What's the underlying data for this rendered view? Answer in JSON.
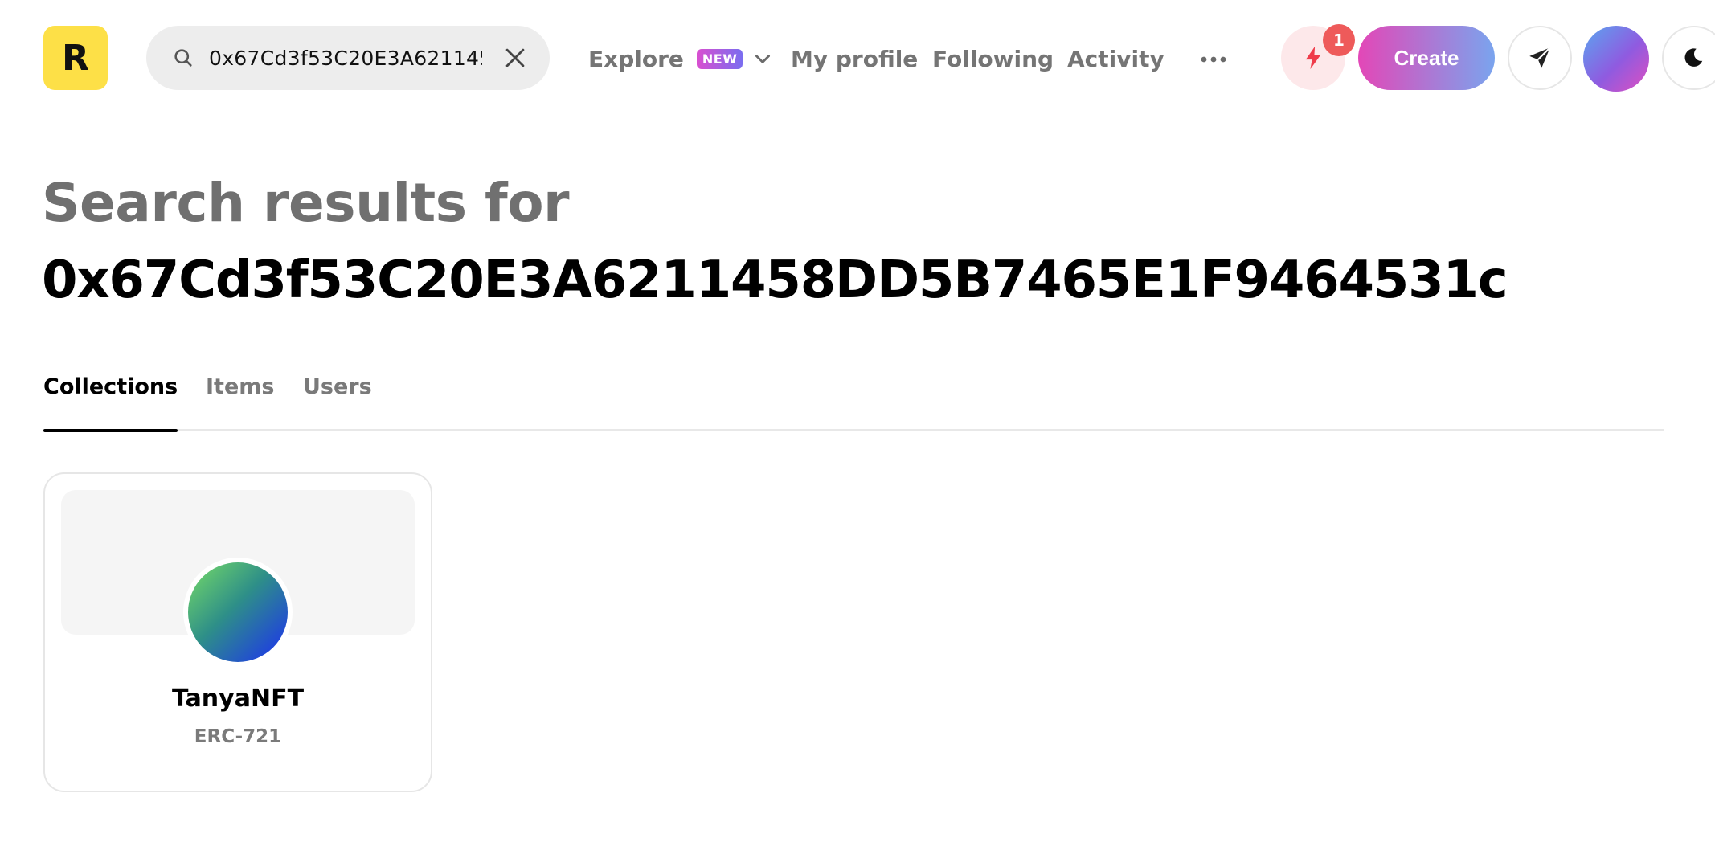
{
  "header": {
    "logo_letter": "R",
    "search": {
      "value": "0x67Cd3f53C20E3A6211458DD5B7465E1F9464531c",
      "placeholder": ""
    },
    "nav": {
      "explore": "Explore",
      "explore_badge": "NEW",
      "my_profile": "My profile",
      "following": "Following",
      "activity": "Activity"
    },
    "notification_count": "1",
    "create_label": "Create"
  },
  "page": {
    "title_line1": "Search results for",
    "query": "0x67Cd3f53C20E3A6211458DD5B7465E1F9464531c"
  },
  "tabs": [
    {
      "label": "Collections",
      "active": true
    },
    {
      "label": "Items",
      "active": false
    },
    {
      "label": "Users",
      "active": false
    }
  ],
  "results": [
    {
      "name": "TanyaNFT",
      "type": "ERC-721"
    }
  ],
  "colors": {
    "logo": "#fde047",
    "notification_badge": "#ee5a5a",
    "create_gradient_start": "#e347b7",
    "create_gradient_end": "#7aa4ee"
  }
}
